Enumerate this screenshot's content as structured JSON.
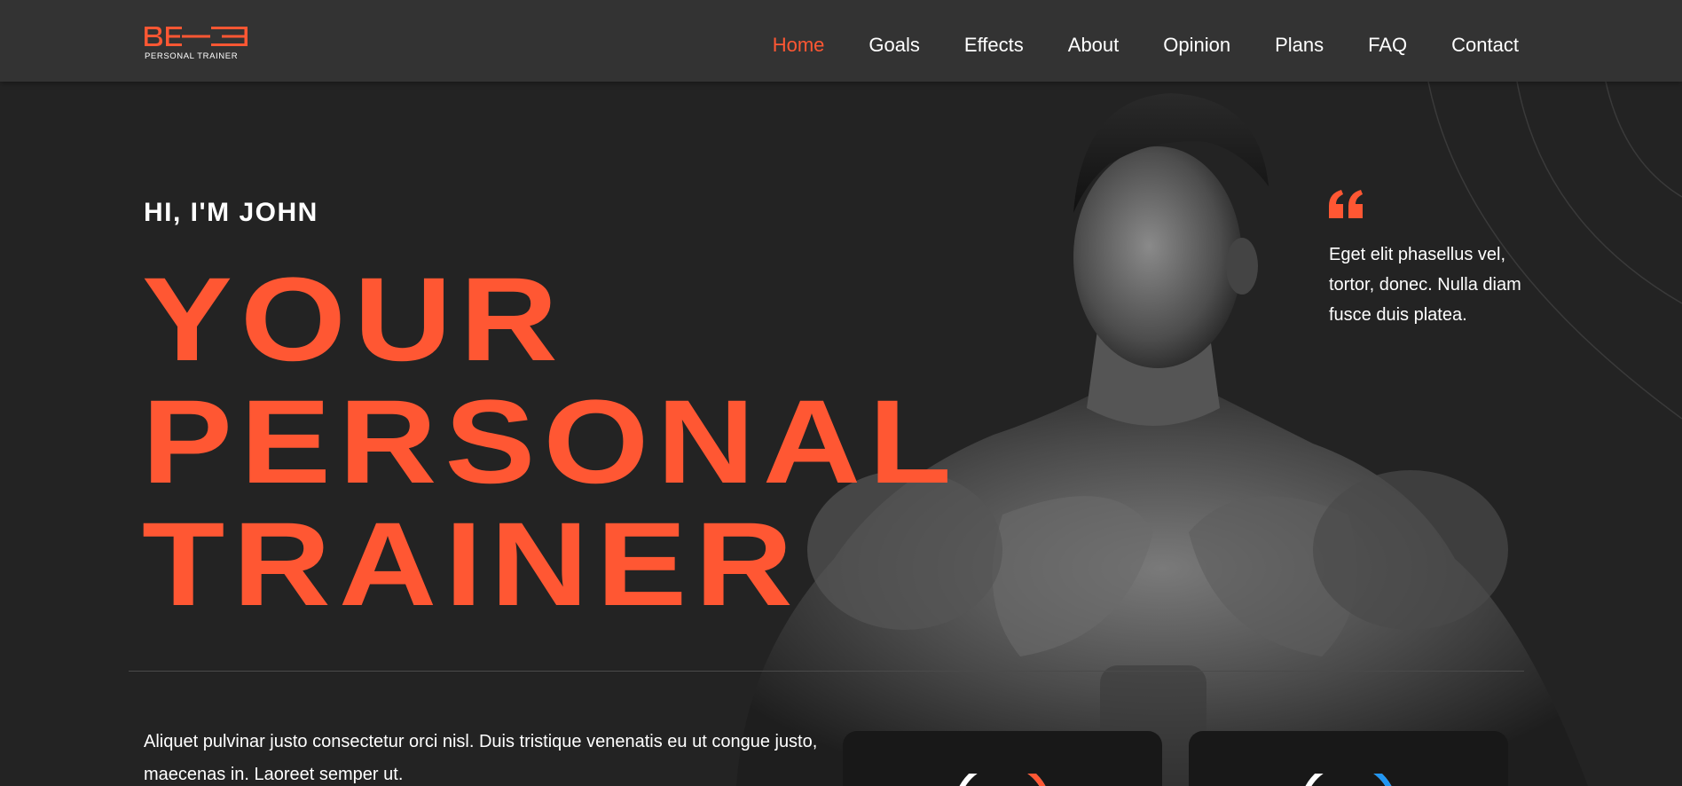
{
  "brand": {
    "logo_mark": "BE",
    "logo_tagline": "PERSONAL TRAINER",
    "accent": "#ff5733"
  },
  "nav": {
    "items": [
      {
        "label": "Home",
        "active": true
      },
      {
        "label": "Goals",
        "active": false
      },
      {
        "label": "Effects",
        "active": false
      },
      {
        "label": "About",
        "active": false
      },
      {
        "label": "Opinion",
        "active": false
      },
      {
        "label": "Plans",
        "active": false
      },
      {
        "label": "FAQ",
        "active": false
      },
      {
        "label": "Contact",
        "active": false
      }
    ]
  },
  "hero": {
    "greeting": "HI, I'M JOHN",
    "headline_lines": [
      "YOUR",
      "PERSONAL",
      "TRAINER"
    ],
    "body": "Aliquet pulvinar justo consectetur orci nisl. Duis tristique venenatis eu ut congue justo, maecenas in. Laoreet semper ut.",
    "quote": "Eget elit phasellus vel, tortor, donec. Nulla diam fusce duis platea.",
    "quote_icon": "quote-open-icon"
  },
  "cards": [
    {
      "ring_color": "#ff5733"
    },
    {
      "ring_color": "#2196f3"
    }
  ],
  "colors": {
    "background": "#232323",
    "header": "#333333",
    "accent": "#ff5733"
  }
}
